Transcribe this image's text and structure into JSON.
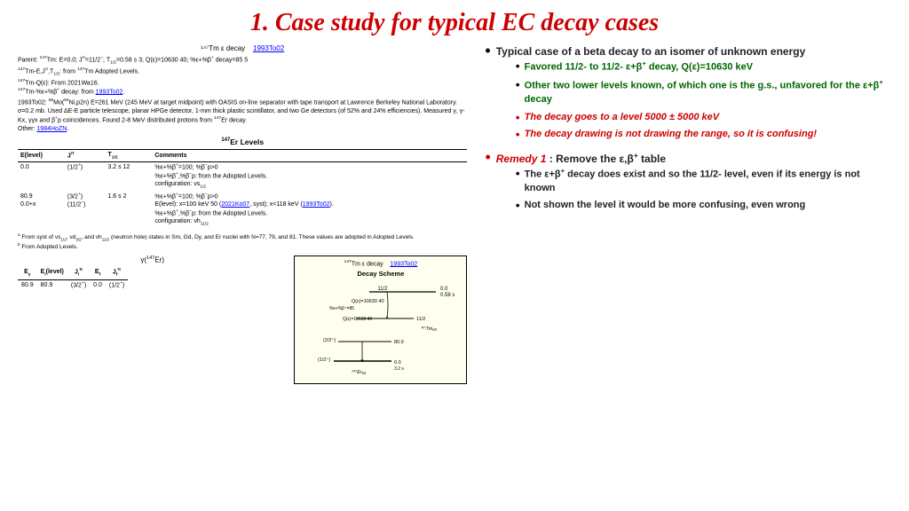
{
  "title": "1. Case study for typical EC decay cases",
  "left": {
    "decay_header": "¹⁴⁷Tm ε decay",
    "decay_ref": "1993To02",
    "parent_lines": [
      "Parent: ¹⁴⁷Tm: E=0.0; Jᵖ=11/2⁻; T₁/₂=0.58 s 3; Q(ε)=10630 40; %ε+%β⁺ decay=85 5",
      "¹⁴⁷Tm-E,Jᵖ,T₁/₂: from ¹⁴⁷Tm Adopted Levels.",
      "¹⁴⁷Tm-Q(ε): From 2021Wa16.",
      "¹⁴⁷Tm-%ε+%β⁺ decay: from 1993To02.",
      "1993To02: ⁵⁸Mo(⁹⁴Ni,p2n) E=261 MeV (245 MeV at target midpoint) with OASIS on-line separator with tape transport at Lawrence Berkeley National Laboratory. σ=0.2 mb. Used ΔE-E particle telescope, planar HPGe detector, 1-mm thick plastic scintillator, and two Ge detectors (of 52% and 24% efficiencies). Measured γ, γ-Kx, γγx and β⁺p coincidences. Found 2-8 MeV distributed protons from ¹⁴⁷Er decay.",
      "Other: 1984HoZN."
    ],
    "er_levels_title": "¹⁴⁷Er Levels",
    "table_headers": [
      "E(level)",
      "Jᵖ",
      "T₁/₂",
      "Comments"
    ],
    "table_rows": [
      {
        "e": "0.0",
        "jp": "(1/2⁺)",
        "t": "3.2 s 12",
        "comments": "%ε+%β⁺=100; %β⁻p>0\n%ε+%β⁺,%β⁻p: from the Adopted Levels.\nconfiguration: νs₁/₂"
      },
      {
        "e": "80.9\n0.0+x",
        "jp": "(3/2⁺)\n(11/2⁻)",
        "t": "1.6 s 2",
        "comments": "%ε+%β⁺=100; %β⁻p>0\nE(level): x=100 keV 50 (2021Ko07, syst); x<118 keV (1993To02).\n%ε+%β⁺,%β⁻p: from the Adopted Levels.\nconfiguration: νh₁₁/₂"
      }
    ],
    "footnotes": [
      "ᵃ From syst of νs₁/₂, νd₃/₂, and νh₁₁/₂ (neutron hole) states in Sm, Gd, Dy, and Er nuclei with N=77, 79, and 81. These values are adopted in Adopted Levels.",
      "ᵇ From Adopted Levels."
    ],
    "gamma_title": "γ(¹⁴⁷Er)",
    "gamma_headers": [
      "Eγ",
      "Eᵢ(level)",
      "Jᵢᵖ",
      "Ef",
      "Jfᵖ"
    ],
    "gamma_rows": [
      [
        "80.9",
        "80.9",
        "(3/2⁺)",
        "0.0",
        "(1/2⁺)"
      ]
    ],
    "scheme_header": "¹⁴⁷Tm ε decay   1993To02",
    "scheme_subtitle": "Decay Scheme"
  },
  "right": {
    "bullets": [
      {
        "type": "main",
        "style": "bold-dark",
        "text": "Typical case of a beta decay to an isomer of unknown energy",
        "subbullets": [
          {
            "style": "bold-green",
            "text": "Favored 11/2- to 11/2- ε+β⁺ decay, Q(ε)=10630 keV"
          },
          {
            "style": "bold-green",
            "text": "Other two lower levels known, of which one is the g.s., unfavored for the ε+β⁺ decay"
          },
          {
            "style": "bold-red",
            "text": "The decay goes to a level 5000 ± 5000 keV"
          },
          {
            "style": "bold-red",
            "text": "The decay drawing is not drawing the range, so it is confusing!"
          }
        ]
      },
      {
        "type": "main",
        "style": "bold-red-main",
        "text": "Remedy 1: Remove the ε,β⁺ table",
        "subbullets": [
          {
            "style": "bold-dark",
            "text": "The ε+β⁺ decay does exist and so the 11/2- level, even if its energy is not known"
          },
          {
            "style": "bold-dark",
            "text": "Not shown the level it would be more confusing, even wrong"
          }
        ]
      }
    ]
  }
}
